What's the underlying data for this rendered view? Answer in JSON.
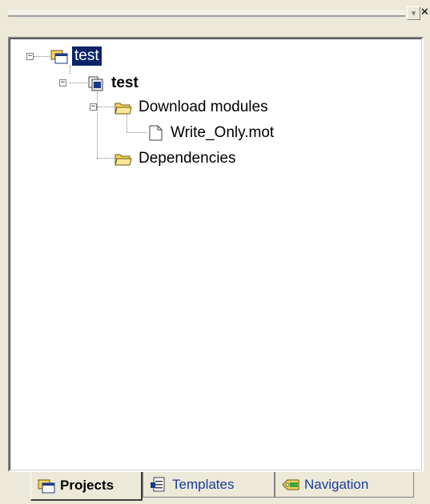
{
  "window": {
    "dropdown_glyph": "▾",
    "close_glyph": "✕"
  },
  "tree": {
    "root": {
      "label": "test",
      "icon": "workspace-icon",
      "expander": "−",
      "selected": true
    },
    "project": {
      "label": "test",
      "icon": "project-icon",
      "expander": "−"
    },
    "folders": [
      {
        "label": "Download modules",
        "icon": "folder-open-icon",
        "expander": "−"
      },
      {
        "label": "Dependencies",
        "icon": "folder-open-icon"
      }
    ],
    "files": [
      {
        "label": "Write_Only.mot",
        "icon": "file-icon"
      }
    ]
  },
  "tabs": [
    {
      "label": "Projects",
      "icon": "workspace-icon",
      "active": true
    },
    {
      "label": "Templates",
      "icon": "templates-icon",
      "active": false
    },
    {
      "label": "Navigation",
      "icon": "navigation-tag-icon",
      "active": false
    }
  ],
  "colors": {
    "chrome": "#ece9d8",
    "selection": "#0a246a",
    "folder": "#f7d35a",
    "tab_text": "#1a3d9a"
  }
}
